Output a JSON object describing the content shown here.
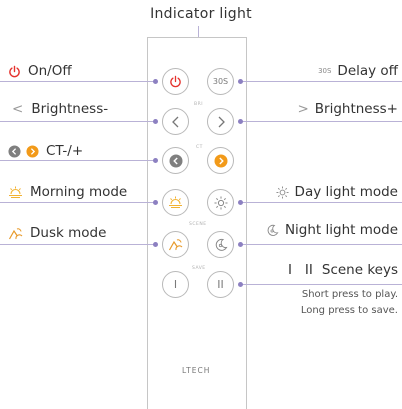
{
  "title": "Indicator light",
  "labels": {
    "on_off": "On/Off",
    "delay_off": "Delay off",
    "brightness_minus": "Brightness-",
    "brightness_plus": "Brightness+",
    "ct": "CT-/+",
    "morning_mode": "Morning mode",
    "day_light_mode": "Day light mode",
    "dusk_mode": "Dusk mode",
    "night_light_mode": "Night light mode",
    "scene_keys": "Scene keys"
  },
  "label_glyphs": {
    "delay_off": "30S",
    "brightness_minus": "<",
    "brightness_plus": ">",
    "scene_keys": "I   II"
  },
  "notes": {
    "line1": "Short press to play.",
    "line2": "Long press to save."
  },
  "remote": {
    "button_30s": "30S",
    "button_scene1": "I",
    "button_scene2": "II",
    "section_bri": "BRI",
    "section_ct": "CT",
    "section_scene": "SCENE",
    "section_save": "SAVE",
    "brand": "LTECH"
  },
  "colors": {
    "power_red": "#e5322d",
    "ct_gray": "#7f7f7f",
    "ct_orange": "#f29a19",
    "leader_line": "#b9b2d6",
    "leader_dot": "#8c80c1",
    "morning_icon": "#f2b233",
    "dusk_icon": "#e89a2a",
    "day_icon": "#888888",
    "night_icon": "#888888"
  }
}
